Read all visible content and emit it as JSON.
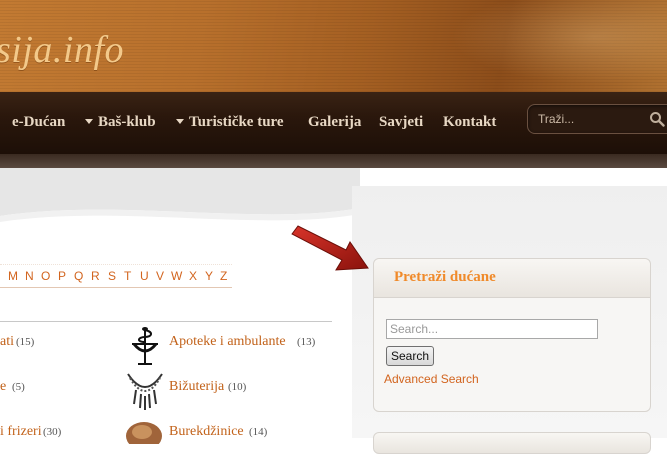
{
  "header": {
    "logo_text": "sija.info"
  },
  "nav": {
    "items": [
      {
        "label": "e-Dućan",
        "dropdown": false
      },
      {
        "label": "Baš-klub",
        "dropdown": true
      },
      {
        "label": "Turističke ture",
        "dropdown": true
      },
      {
        "label": "Galerija",
        "dropdown": false
      },
      {
        "label": "Savjeti",
        "dropdown": false
      },
      {
        "label": "Kontakt",
        "dropdown": false
      }
    ],
    "search_placeholder": "Traži...",
    "search_icon": "search-icon"
  },
  "alphabet": [
    "M",
    "N",
    "O",
    "P",
    "Q",
    "R",
    "S",
    "T",
    "U",
    "V",
    "W",
    "X",
    "Y",
    "Z"
  ],
  "categories": {
    "left": [
      {
        "label": "ati",
        "count": "(15)"
      },
      {
        "label": "e",
        "count": "(5)"
      },
      {
        "label": "i frizeri",
        "count": "(30)"
      }
    ],
    "right": [
      {
        "label": "Apoteke i ambulante",
        "count": "(13)",
        "icon": "pharmacy-icon"
      },
      {
        "label": "Bižuterija",
        "count": "(10)",
        "icon": "necklace-icon"
      },
      {
        "label": "Burekdžinice",
        "count": "(14)",
        "icon": "burek-icon"
      }
    ]
  },
  "widget": {
    "title": "Pretraži dućane",
    "search_placeholder": "Search...",
    "search_button": "Search",
    "advanced_link": "Advanced Search"
  },
  "colors": {
    "accent": "#f08a2a",
    "link": "#c2621a",
    "nav_bg": "#2a170c",
    "arrow": "#b01c14"
  }
}
